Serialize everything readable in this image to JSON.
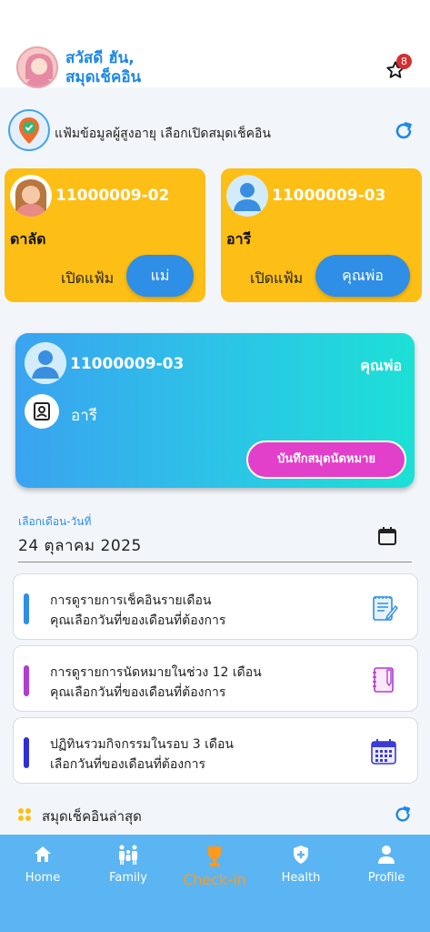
{
  "header": {
    "greeting_line1": "สวัสดี ฮัน,",
    "greeting_line2": "สมุดเช็คอิน",
    "notification_count": "8"
  },
  "elder_section": {
    "title": "แฟ้มข้อมูลผู้สูงอายุ เลือกเปิดสมุดเช็คอิน"
  },
  "elder_cards": [
    {
      "code": "11000009-02",
      "name": "ดาลัด",
      "open_label": "เปิดแฟ้ม",
      "relation": "แม่"
    },
    {
      "code": "11000009-03",
      "name": "อารี",
      "open_label": "เปิดแฟ้ม",
      "relation": "คุณพ่อ"
    }
  ],
  "selected_card": {
    "code": "11000009-03",
    "relation": "คุณพ่อ",
    "name": "อารี",
    "save_button": "บันทึกสมุดนัดหมาย"
  },
  "date_picker": {
    "label": "เลือกเดือน-วันที่",
    "value": "24 ตุลาคม 2025"
  },
  "options": [
    {
      "line1": "การดูรายการเช็คอินรายเดือน",
      "line2": "คุณเลือกวันที่ของเดือนที่ต้องการ",
      "color": "#2f8ee6",
      "icon": "notepad-icon"
    },
    {
      "line1": "การดูรายการนัดหมายในช่วง 12 เดือน",
      "line2": "คุณเลือกวันที่ของเดือนที่ต้องการ",
      "color": "#b13ccf",
      "icon": "notebook-icon"
    },
    {
      "line1": "ปฏิทินรวมกิจกรรมในรอบ 3 เดือน",
      "line2": "เลือกวันที่ของเดือนที่ต้องการ",
      "color": "#2f2fd6",
      "icon": "calendar-grid-icon"
    }
  ],
  "latest": {
    "title": "สมุดเช็คอินล่าสุด"
  },
  "nav": {
    "items": [
      {
        "label": "Home",
        "icon": "home-icon"
      },
      {
        "label": "Family",
        "icon": "family-icon"
      },
      {
        "label": "Check-in",
        "icon": "trophy-icon",
        "active": true
      },
      {
        "label": "Health",
        "icon": "shield-plus-icon"
      },
      {
        "label": "Profile",
        "icon": "person-icon"
      }
    ]
  },
  "colors": {
    "primary": "#2f8ee6",
    "card_yellow": "#fdbf15",
    "save_pink": "#e23fcb",
    "nav_bg": "#5bb5f3",
    "active_nav": "#ff9a1a"
  }
}
